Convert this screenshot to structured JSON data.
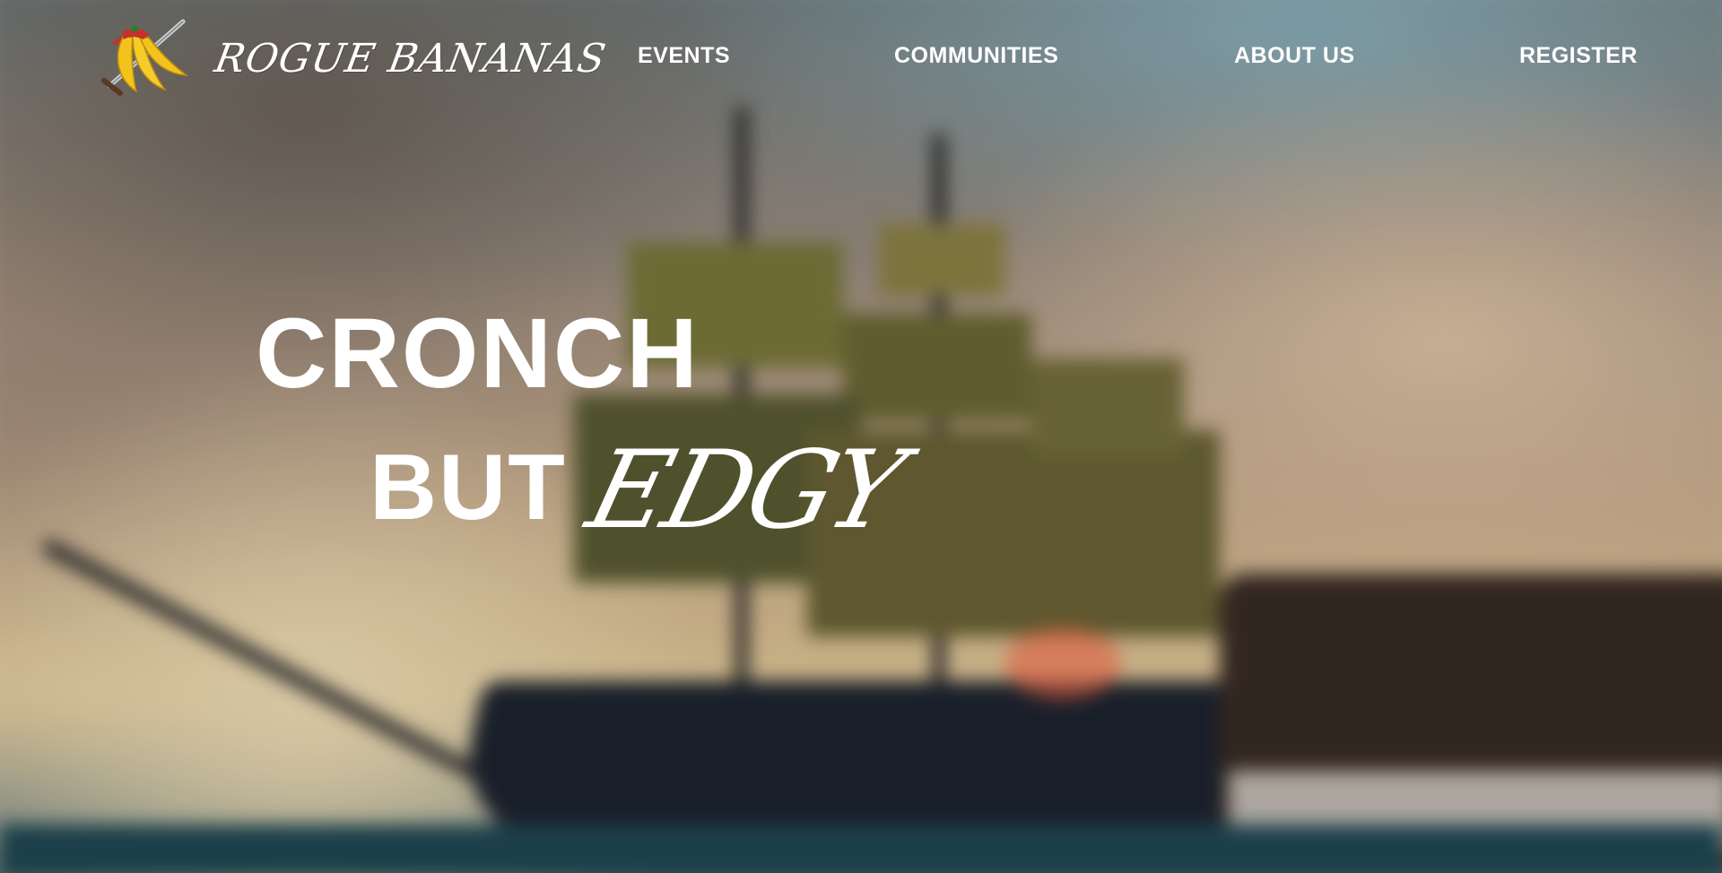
{
  "brand": {
    "name": "ROGUE BANANAS",
    "logo_icon": "banana-sword-logo-icon"
  },
  "nav": {
    "items": [
      {
        "label": "EVENTS"
      },
      {
        "label": "COMMUNITIES"
      },
      {
        "label": "ABOUT US"
      },
      {
        "label": "REGISTER"
      }
    ]
  },
  "hero": {
    "line1": "CRONCH",
    "line2_plain": "BUT",
    "line2_accent": "EDGY"
  },
  "colors": {
    "text": "#ffffff",
    "banana_yellow": "#f4c21c",
    "bandana_red": "#c8312b"
  }
}
